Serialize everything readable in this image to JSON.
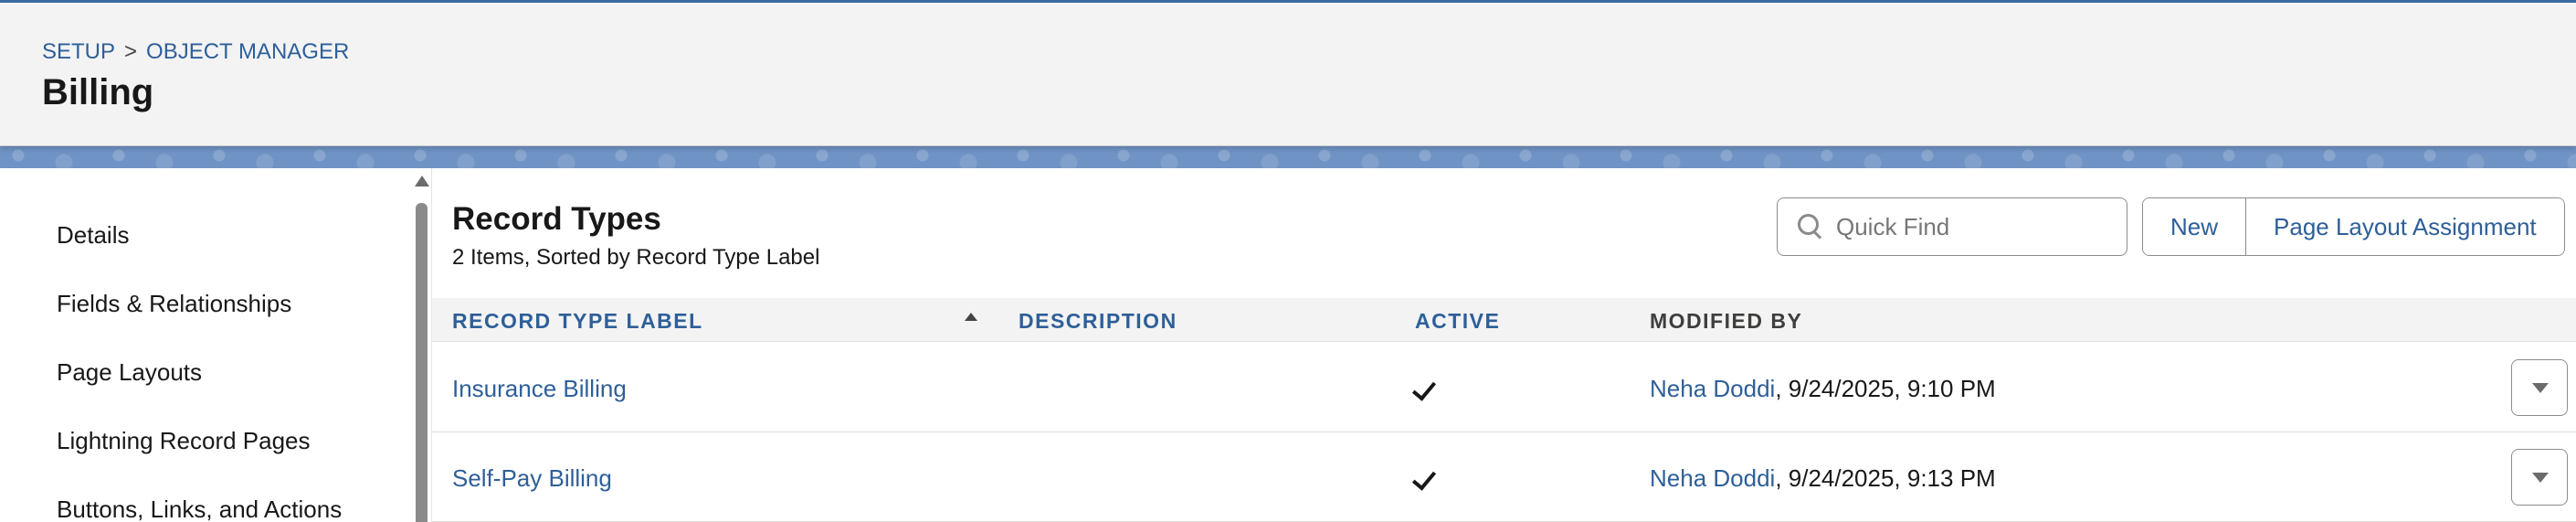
{
  "breadcrumb": {
    "setup": "SETUP",
    "separator": ">",
    "object_manager": "OBJECT MANAGER"
  },
  "page": {
    "title": "Billing"
  },
  "sidebar": {
    "items": [
      {
        "label": "Details"
      },
      {
        "label": "Fields & Relationships"
      },
      {
        "label": "Page Layouts"
      },
      {
        "label": "Lightning Record Pages"
      },
      {
        "label": "Buttons, Links, and Actions"
      }
    ]
  },
  "main": {
    "title": "Record Types",
    "subtitle": "2 Items, Sorted by Record Type Label",
    "quick_find_placeholder": "Quick Find",
    "buttons": {
      "new": "New",
      "page_layout_assignment": "Page Layout Assignment"
    }
  },
  "table": {
    "headers": {
      "label": "RECORD TYPE LABEL",
      "description": "DESCRIPTION",
      "active": "ACTIVE",
      "modified_by": "MODIFIED BY"
    },
    "rows": [
      {
        "label": "Insurance Billing",
        "description": "",
        "active": true,
        "modified_user": "Neha Doddi",
        "modified_date": ", 9/24/2025, 9:10 PM"
      },
      {
        "label": "Self-Pay Billing",
        "description": "",
        "active": true,
        "modified_user": "Neha Doddi",
        "modified_date": ", 9/24/2025, 9:13 PM"
      }
    ]
  },
  "colors": {
    "link": "#2e5f99",
    "header_bg": "#f3f3f3",
    "band": "#6f93c4",
    "top_border": "#3a6a9e"
  },
  "icons": {
    "search": "search-icon",
    "sort": "sort-ascending-icon",
    "check": "check-icon",
    "row_menu": "chevron-down-icon"
  }
}
